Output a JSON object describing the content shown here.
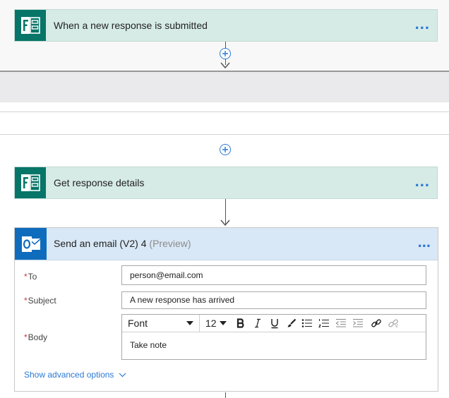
{
  "flow": {
    "trigger": {
      "title": "When a new response is submitted",
      "more": "..."
    },
    "step1": {
      "title": "Get response details",
      "more": "..."
    },
    "email": {
      "title": "Send an email (V2) 4",
      "preview": "(Preview)",
      "more": "...",
      "to": {
        "label": "To",
        "value": "person@email.com"
      },
      "subject": {
        "label": "Subject",
        "value": "A new response has arrived"
      },
      "body": {
        "label": "Body",
        "font": "Font",
        "size": "12",
        "content": "Take note"
      },
      "advanced_link": "Show advanced options"
    }
  },
  "icons": {
    "trigger_icon": "microsoft-forms-icon",
    "step1_icon": "microsoft-forms-icon",
    "email_icon": "outlook-icon",
    "add": "plus-circle-icon"
  },
  "colors": {
    "forms_green": "#077568",
    "outlook_blue": "#0f6cbd",
    "link_blue": "#2b79d4",
    "required_red": "#d13438"
  },
  "required_marker": "*"
}
